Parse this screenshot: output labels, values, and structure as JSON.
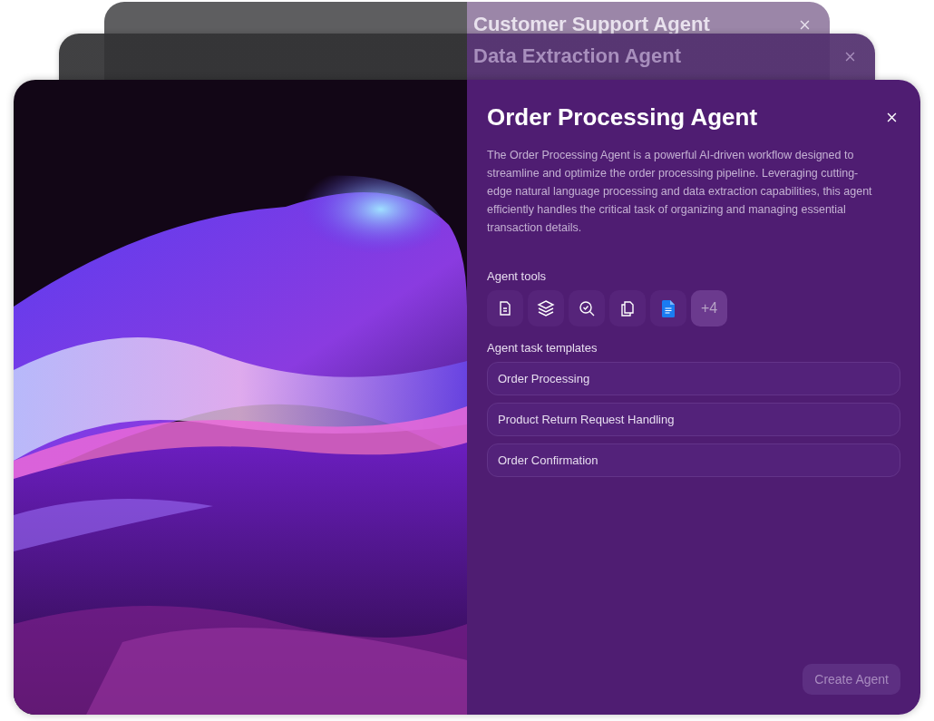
{
  "background_cards": [
    {
      "title": "Customer Support Agent"
    },
    {
      "title": "Data Extraction Agent"
    }
  ],
  "card": {
    "title": "Order Processing Agent",
    "description": "The Order Processing Agent is a powerful AI-driven workflow designed to streamline and optimize the order processing pipeline. Leveraging cutting-edge natural language processing and data extraction capabilities, this agent efficiently handles the critical task of organizing and managing essential transaction details.",
    "tools_label": "Agent tools",
    "tools": [
      {
        "kind": "document"
      },
      {
        "kind": "layers"
      },
      {
        "kind": "search-check"
      },
      {
        "kind": "copy"
      },
      {
        "kind": "doc-blue"
      }
    ],
    "tools_more": "+4",
    "templates_label": "Agent task templates",
    "templates": [
      "Order Processing",
      "Product Return Request Handling",
      "Order Confirmation"
    ],
    "create_button": {
      "label": "Create Agent",
      "disabled": true
    }
  }
}
